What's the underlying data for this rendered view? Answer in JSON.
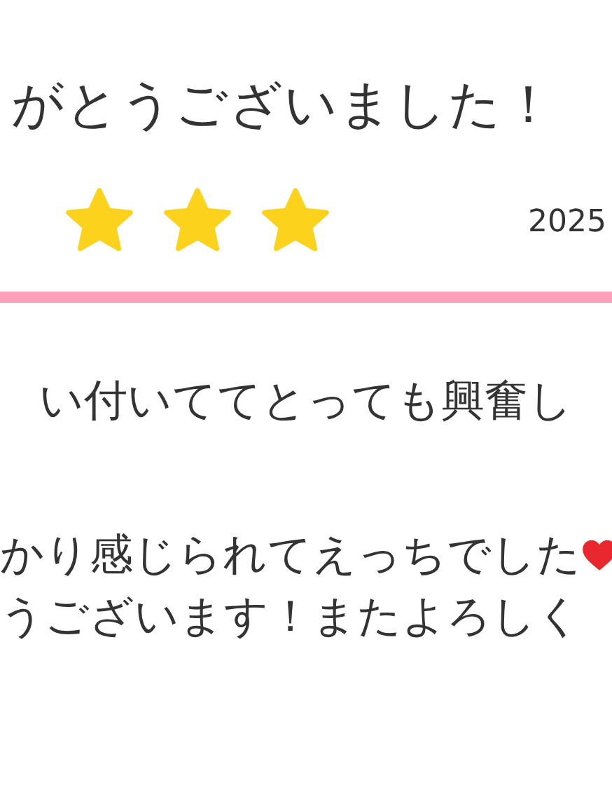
{
  "review": {
    "title": "がとうございました！",
    "stars": 3,
    "date": "2025",
    "paragraphs": [
      [
        {
          "text": "い付いててとっても興奮し",
          "heart": false
        }
      ],
      [
        {
          "text": "かり感じられてえっちでした",
          "heart": true
        },
        {
          "text": "うございます！またよろしく",
          "heart": false
        }
      ]
    ]
  }
}
